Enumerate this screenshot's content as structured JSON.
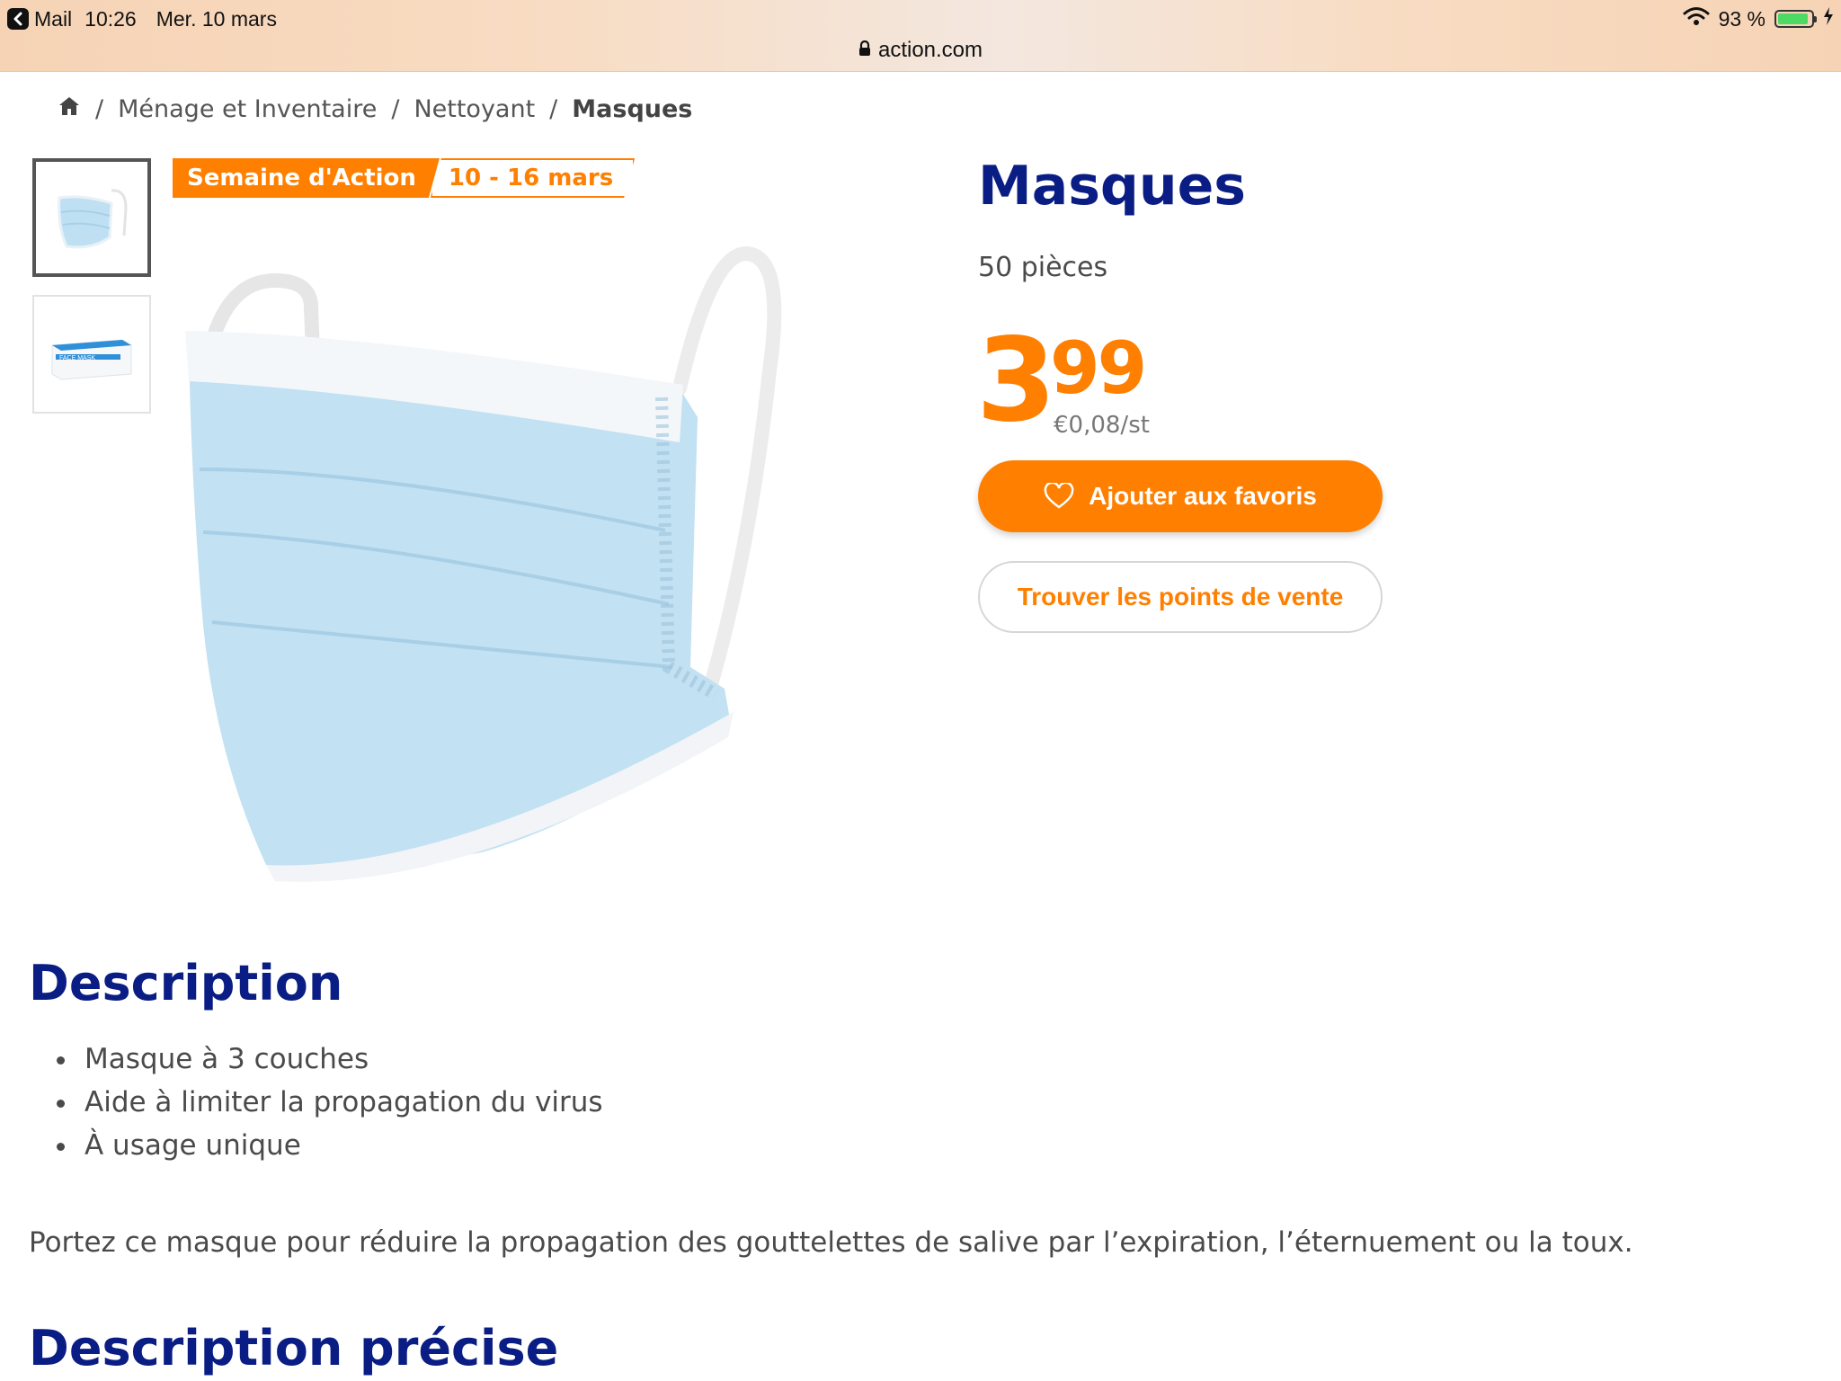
{
  "status_bar": {
    "back_app": "Mail",
    "time": "10:26",
    "date": "Mer. 10 mars",
    "battery": "93 %",
    "battery_level": 0.93
  },
  "browser": {
    "url": "action.com"
  },
  "breadcrumb": {
    "items": [
      "Ménage et Inventaire",
      "Nettoyant"
    ],
    "current": "Masques"
  },
  "promo": {
    "label": "Semaine d'Action",
    "dates": "10 - 16 mars"
  },
  "thumbnails": {
    "box_text": "FACE MASK"
  },
  "product": {
    "title": "Masques",
    "subtitle": "50 pièces",
    "price_int": "3",
    "price_dec": "99",
    "unit_price": "€0,08/st",
    "fav_button": "Ajouter aux favoris",
    "store_button": "Trouver les points de vente"
  },
  "description": {
    "title": "Description",
    "bullets": [
      "Masque à 3 couches",
      "Aide à limiter la propagation du virus",
      "À usage unique"
    ],
    "paragraph": "Portez ce masque pour réduire la propagation des gouttelettes de salive par l’expiration, l’éternuement ou la toux."
  },
  "precise": {
    "title": "Description précise"
  },
  "colors": {
    "accent": "#ff7f00",
    "title_blue": "#0a1d84",
    "mask_blue": "#bfe0f2"
  }
}
